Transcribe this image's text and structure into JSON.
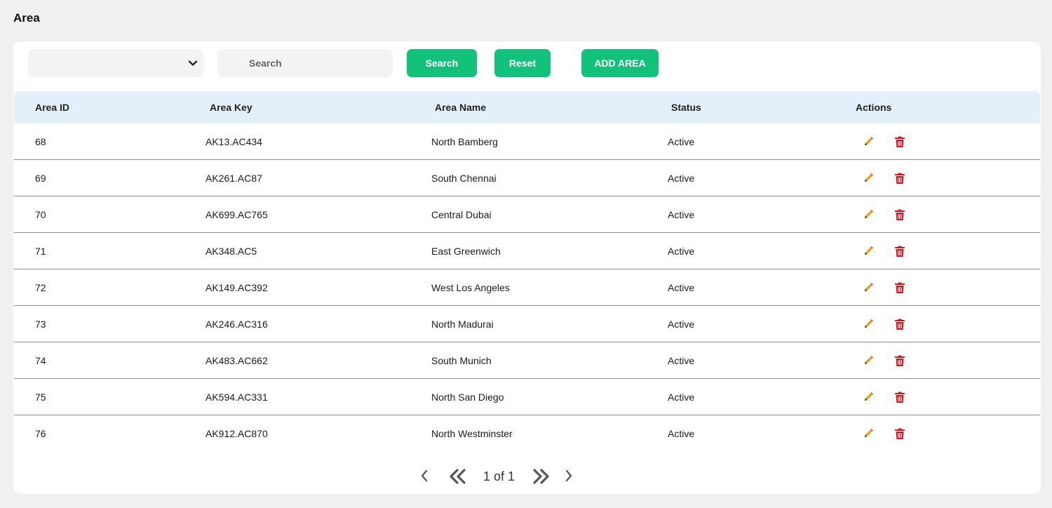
{
  "page": {
    "title": "Area"
  },
  "toolbar": {
    "select_value": "",
    "search_placeholder": "Search",
    "search_button": "Search",
    "reset_button": "Reset",
    "add_button": "ADD AREA"
  },
  "table": {
    "headers": {
      "id": "Area ID",
      "key": "Area Key",
      "name": "Area Name",
      "status": "Status",
      "actions": "Actions"
    },
    "rows": [
      {
        "id": "68",
        "key": "AK13.AC434",
        "name": "North Bamberg",
        "status": "Active"
      },
      {
        "id": "69",
        "key": "AK261.AC87",
        "name": "South Chennai",
        "status": "Active"
      },
      {
        "id": "70",
        "key": "AK699.AC765",
        "name": "Central Dubai",
        "status": "Active"
      },
      {
        "id": "71",
        "key": "AK348.AC5",
        "name": "East Greenwich",
        "status": "Active"
      },
      {
        "id": "72",
        "key": "AK149.AC392",
        "name": "West Los Angeles",
        "status": "Active"
      },
      {
        "id": "73",
        "key": "AK246.AC316",
        "name": "North Madurai",
        "status": "Active"
      },
      {
        "id": "74",
        "key": "AK483.AC662",
        "name": "South Munich",
        "status": "Active"
      },
      {
        "id": "75",
        "key": "AK594.AC331",
        "name": "North San Diego",
        "status": "Active"
      },
      {
        "id": "76",
        "key": "AK912.AC870",
        "name": "North Westminster",
        "status": "Active"
      }
    ]
  },
  "pagination": {
    "text": "1 of 1"
  },
  "colors": {
    "accent": "#13c27a",
    "header_bg": "#e3f0f9",
    "edit_icon": "#e8a317",
    "delete_icon": "#e0101e"
  },
  "icons": {
    "select": "chevron-down-icon",
    "edit": "pencil-icon",
    "delete": "trash-icon",
    "prev": "chevron-left-icon",
    "first": "double-chevron-left-icon",
    "last": "double-chevron-right-icon",
    "next": "chevron-right-icon"
  }
}
